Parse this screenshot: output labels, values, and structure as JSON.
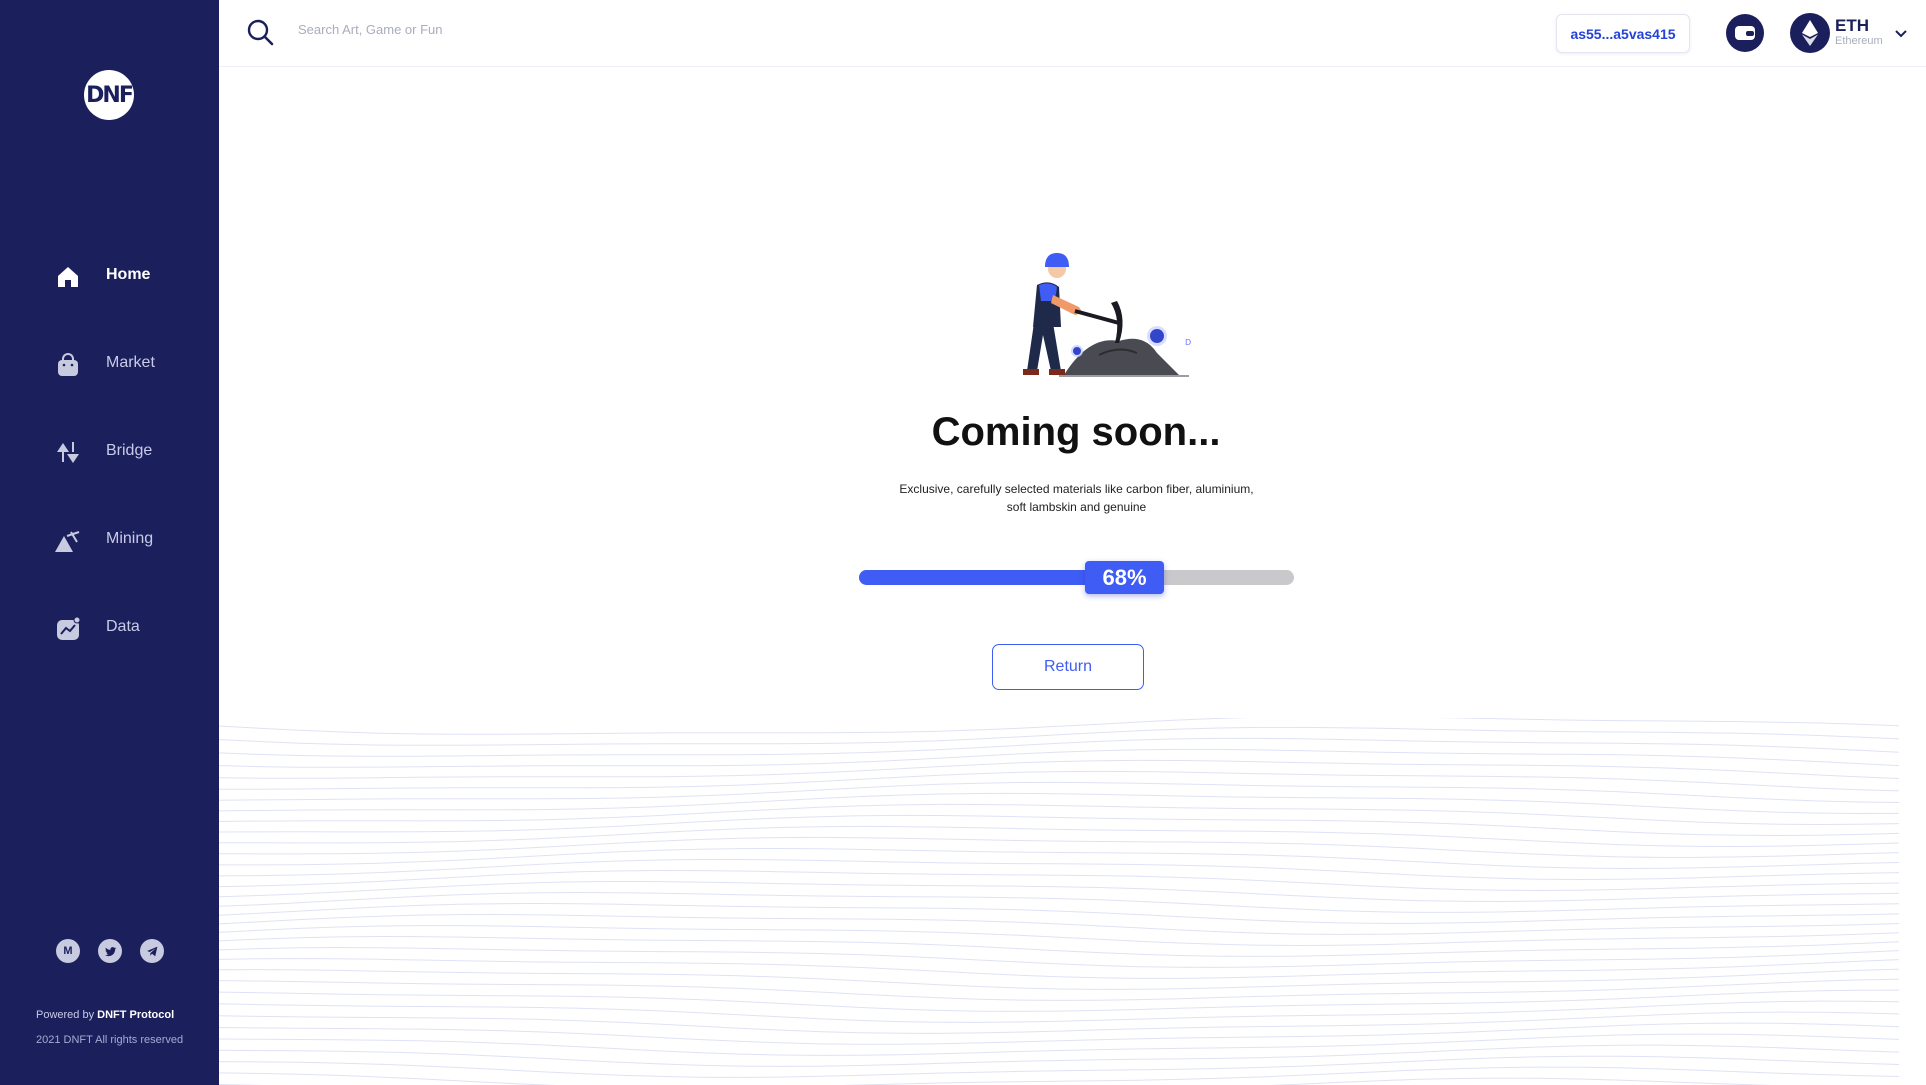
{
  "brand": {
    "logo_text": "DNF"
  },
  "sidebar": {
    "items": [
      {
        "label": "Home",
        "icon": "home-icon",
        "active": true
      },
      {
        "label": "Market",
        "icon": "bag-icon",
        "active": false
      },
      {
        "label": "Bridge",
        "icon": "bridge-icon",
        "active": false
      },
      {
        "label": "Mining",
        "icon": "mining-icon",
        "active": false
      },
      {
        "label": "Data",
        "icon": "chart-icon",
        "active": false
      }
    ],
    "socials": [
      {
        "icon": "medium-icon",
        "glyph": "M"
      },
      {
        "icon": "twitter-icon",
        "glyph": ""
      },
      {
        "icon": "telegram-icon",
        "glyph": ""
      }
    ],
    "powered_prefix": "Powered by",
    "powered_brand": "DNFT Protocol",
    "rights": "2021 DNFT All rights reserved"
  },
  "header": {
    "search_placeholder": "Search Art, Game or Fun",
    "wallet_address": "as55...a5vas415",
    "network_name": "ETH",
    "network_sub": "Ethereum"
  },
  "main": {
    "title": "Coming soon...",
    "description": "Exclusive, carefully selected materials like carbon fiber, aluminium, soft lambskin and genuine",
    "progress_label": "68%",
    "progress_value": 0.54,
    "return_label": "Return"
  },
  "colors": {
    "sidebar": "#1b1f5c",
    "accent": "#3f5cf4",
    "track": "#c9c9cc"
  }
}
